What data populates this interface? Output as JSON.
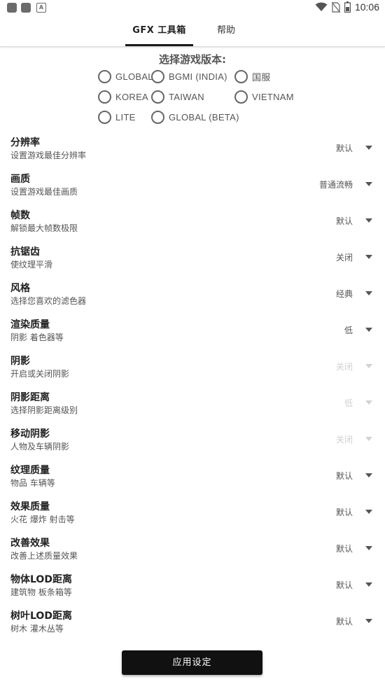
{
  "status_bar": {
    "time": "10:06",
    "icons": [
      "notification-icon",
      "notification-icon",
      "app-a-icon",
      "wifi-icon",
      "no-sim-icon",
      "battery-icon"
    ]
  },
  "tabs": [
    {
      "label": "GFX 工具箱",
      "active": true
    },
    {
      "label": "帮助",
      "active": false
    }
  ],
  "version": {
    "title": "选择游戏版本:",
    "options": [
      "GLOBAL",
      "BGMI (INDIA)",
      "国服",
      "KOREA",
      "TAIWAN",
      "VIETNAM",
      "LITE",
      "GLOBAL (BETA)"
    ]
  },
  "settings": [
    {
      "title": "分辨率",
      "sub": "设置游戏最佳分辨率",
      "value": "默认"
    },
    {
      "title": "画质",
      "sub": "设置游戏最佳画质",
      "value": "普通流畅"
    },
    {
      "title": "帧数",
      "sub": "解锁最大帧数极限",
      "value": "默认"
    },
    {
      "title": "抗锯齿",
      "sub": "使纹理平滑",
      "value": "关闭"
    },
    {
      "title": "风格",
      "sub": "选择您喜欢的滤色器",
      "value": "经典"
    },
    {
      "title": "渲染质量",
      "sub": "阴影 着色器等",
      "value": "低"
    },
    {
      "title": "阴影",
      "sub": "开启或关闭阴影",
      "value": "关闭"
    },
    {
      "title": "阴影距离",
      "sub": "选择阴影距离级别",
      "value": "低"
    },
    {
      "title": "移动阴影",
      "sub": "人物及车辆阴影",
      "value": "关闭"
    },
    {
      "title": "纹理质量",
      "sub": "物品 车辆等",
      "value": "默认"
    },
    {
      "title": "效果质量",
      "sub": "火花 爆炸 射击等",
      "value": "默认"
    },
    {
      "title": "改善效果",
      "sub": "改善上述质量效果",
      "value": "默认"
    },
    {
      "title": "物体LOD距离",
      "sub": "建筑物 板条箱等",
      "value": "默认"
    },
    {
      "title": "树叶LOD距离",
      "sub": "树木 灌木丛等",
      "value": "默认"
    }
  ],
  "apply_button": "应用设定"
}
